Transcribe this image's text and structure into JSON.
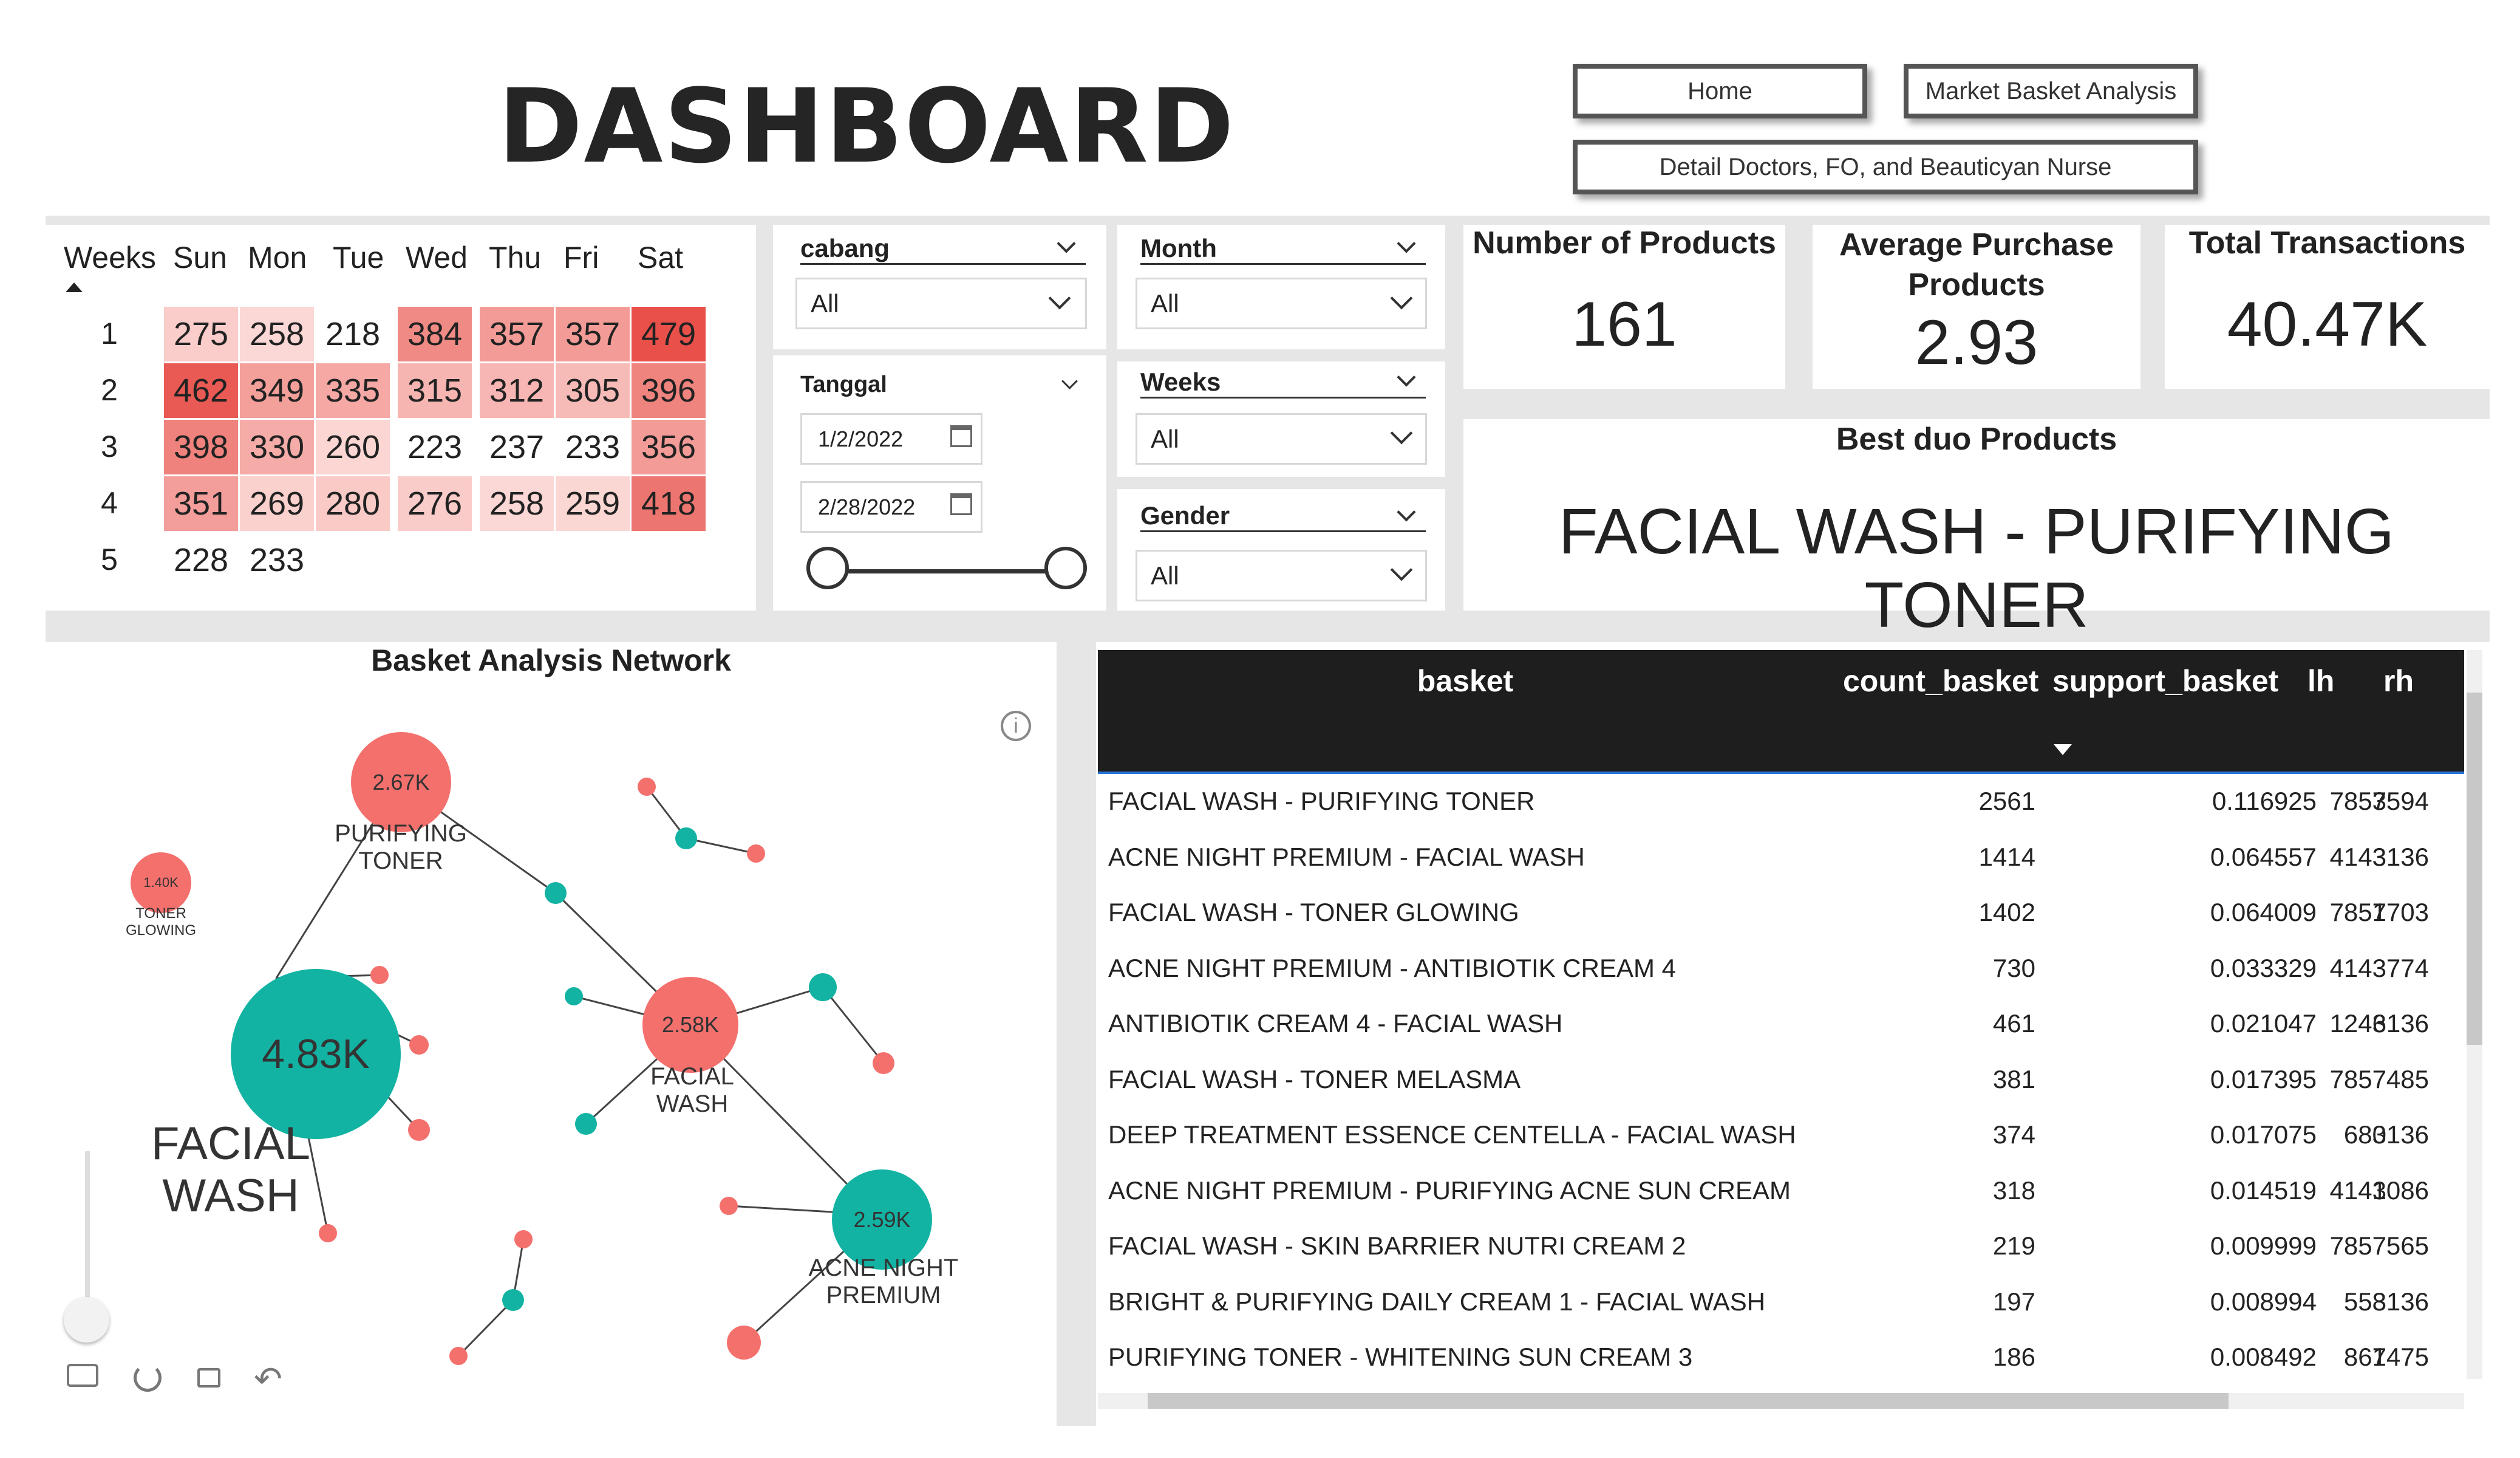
{
  "header": {
    "title": "DASHBOARD",
    "nav": [
      "Home",
      "Market Basket Analysis",
      "Detail Doctors, FO, and Beauticyan Nurse"
    ]
  },
  "heatmap": {
    "columns": [
      "Weeks",
      "Sun",
      "Mon",
      "Tue",
      "Wed",
      "Thu",
      "Fri",
      "Sat"
    ],
    "rows": [
      {
        "week": "1",
        "values": [
          "275",
          "258",
          "218",
          "384",
          "357",
          "357",
          "479"
        ]
      },
      {
        "week": "2",
        "values": [
          "462",
          "349",
          "335",
          "315",
          "312",
          "305",
          "396"
        ]
      },
      {
        "week": "3",
        "values": [
          "398",
          "330",
          "260",
          "223",
          "237",
          "233",
          "356"
        ]
      },
      {
        "week": "4",
        "values": [
          "351",
          "269",
          "280",
          "276",
          "258",
          "259",
          "418"
        ]
      },
      {
        "week": "5",
        "values": [
          "228",
          "233",
          "",
          "",
          "",
          "",
          ""
        ]
      }
    ]
  },
  "slicers": {
    "cabang": {
      "label": "cabang",
      "value": "All"
    },
    "month": {
      "label": "Month",
      "value": "All"
    },
    "weeks": {
      "label": "Weeks",
      "value": "All"
    },
    "gender": {
      "label": "Gender",
      "value": "All"
    },
    "tanggal": {
      "label": "Tanggal",
      "start": "1/2/2022",
      "end": "2/28/2022"
    }
  },
  "cards": {
    "products": {
      "label": "Number of Products",
      "value": "161"
    },
    "avg": {
      "label": "Average Purchase Products",
      "value": "2.93"
    },
    "transactions": {
      "label": "Total Transactions",
      "value": "40.47K"
    },
    "best_duo": {
      "label": "Best duo Products",
      "value": "FACIAL WASH - PURIFYING TONER"
    }
  },
  "network": {
    "title": "Basket Analysis Network",
    "nodes": [
      {
        "value": "4.83K",
        "name": "FACIAL WASH"
      },
      {
        "value": "2.67K",
        "name": "PURIFYING TONER"
      },
      {
        "value": "2.58K",
        "name": "FACIAL WASH"
      },
      {
        "value": "2.59K",
        "name": "ACNE NIGHT PREMIUM"
      },
      {
        "value": "1.40K",
        "name": "TONER GLOWING"
      }
    ]
  },
  "table": {
    "columns": [
      "basket",
      "count_basket",
      "support_basket",
      "lh",
      "rh"
    ],
    "rows": [
      [
        "FACIAL WASH - PURIFYING TONER",
        "2561",
        "0.116925",
        "7857",
        "3594"
      ],
      [
        "ACNE NIGHT PREMIUM - FACIAL WASH",
        "1414",
        "0.064557",
        "4143",
        "3136"
      ],
      [
        "FACIAL WASH - TONER GLOWING",
        "1402",
        "0.064009",
        "7857",
        "1703"
      ],
      [
        "ACNE NIGHT PREMIUM - ANTIBIOTIK CREAM 4",
        "730",
        "0.033329",
        "4143",
        "774"
      ],
      [
        "ANTIBIOTIK CREAM 4 - FACIAL WASH",
        "461",
        "0.021047",
        "1246",
        "3136"
      ],
      [
        "FACIAL WASH - TONER MELASMA",
        "381",
        "0.017395",
        "7857",
        "485"
      ],
      [
        "DEEP TREATMENT ESSENCE CENTELLA - FACIAL WASH",
        "374",
        "0.017075",
        "680",
        "3136"
      ],
      [
        "ACNE NIGHT PREMIUM - PURIFYING ACNE SUN CREAM",
        "318",
        "0.014519",
        "4143",
        "1086"
      ],
      [
        "FACIAL WASH - SKIN BARRIER NUTRI CREAM 2",
        "219",
        "0.009999",
        "7857",
        "565"
      ],
      [
        "BRIGHT & PURIFYING DAILY CREAM 1 - FACIAL WASH",
        "197",
        "0.008994",
        "558",
        "3136"
      ],
      [
        "PURIFYING TONER - WHITENING SUN CREAM 3",
        "186",
        "0.008492",
        "867",
        "1475"
      ]
    ]
  },
  "colors": {
    "heat_high": "#e8524f",
    "node_red": "#f4706d",
    "node_teal": "#13b3a3",
    "table_header": "#1e1e1e"
  }
}
